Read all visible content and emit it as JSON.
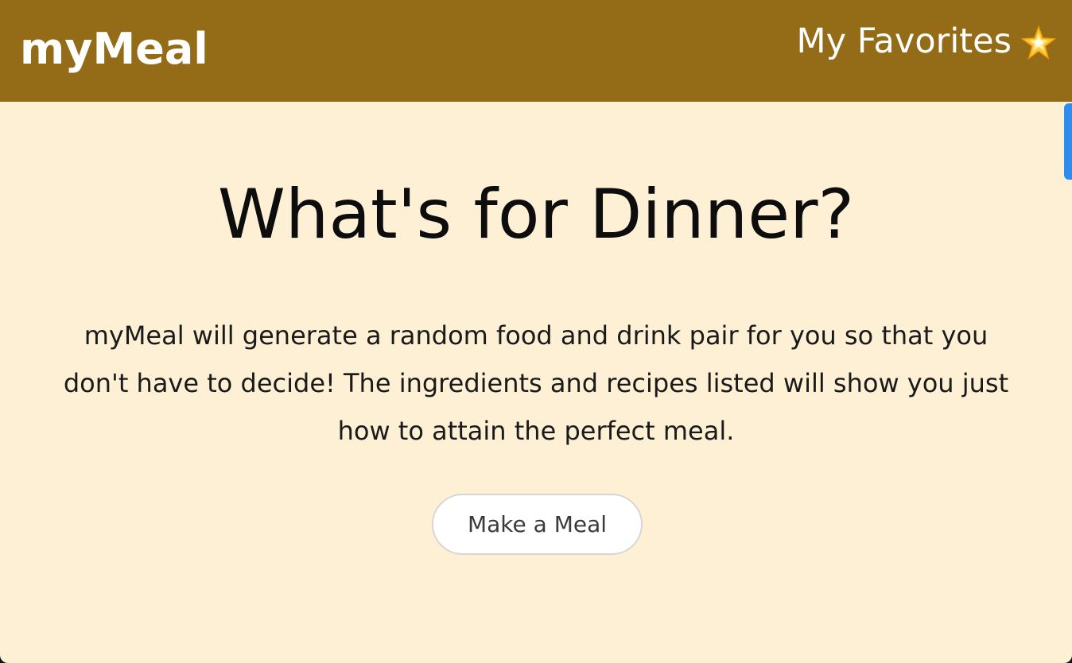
{
  "navbar": {
    "brand": "myMeal",
    "favorites_label": "My Favorites",
    "favorites_icon": "glowing-star-icon",
    "background_color": "#946c17"
  },
  "hero": {
    "title": "What's for Dinner?",
    "description_lines": [
      "myMeal will generate a random food and drink pair for you so that you",
      "don't have to decide! The ingredients and recipes listed will show you just",
      "how to attain the perfect meal."
    ],
    "button_label": "Make a Meal"
  },
  "colors": {
    "page_background": "#fdf0d5",
    "accent_scroll": "#2d8cf0"
  }
}
